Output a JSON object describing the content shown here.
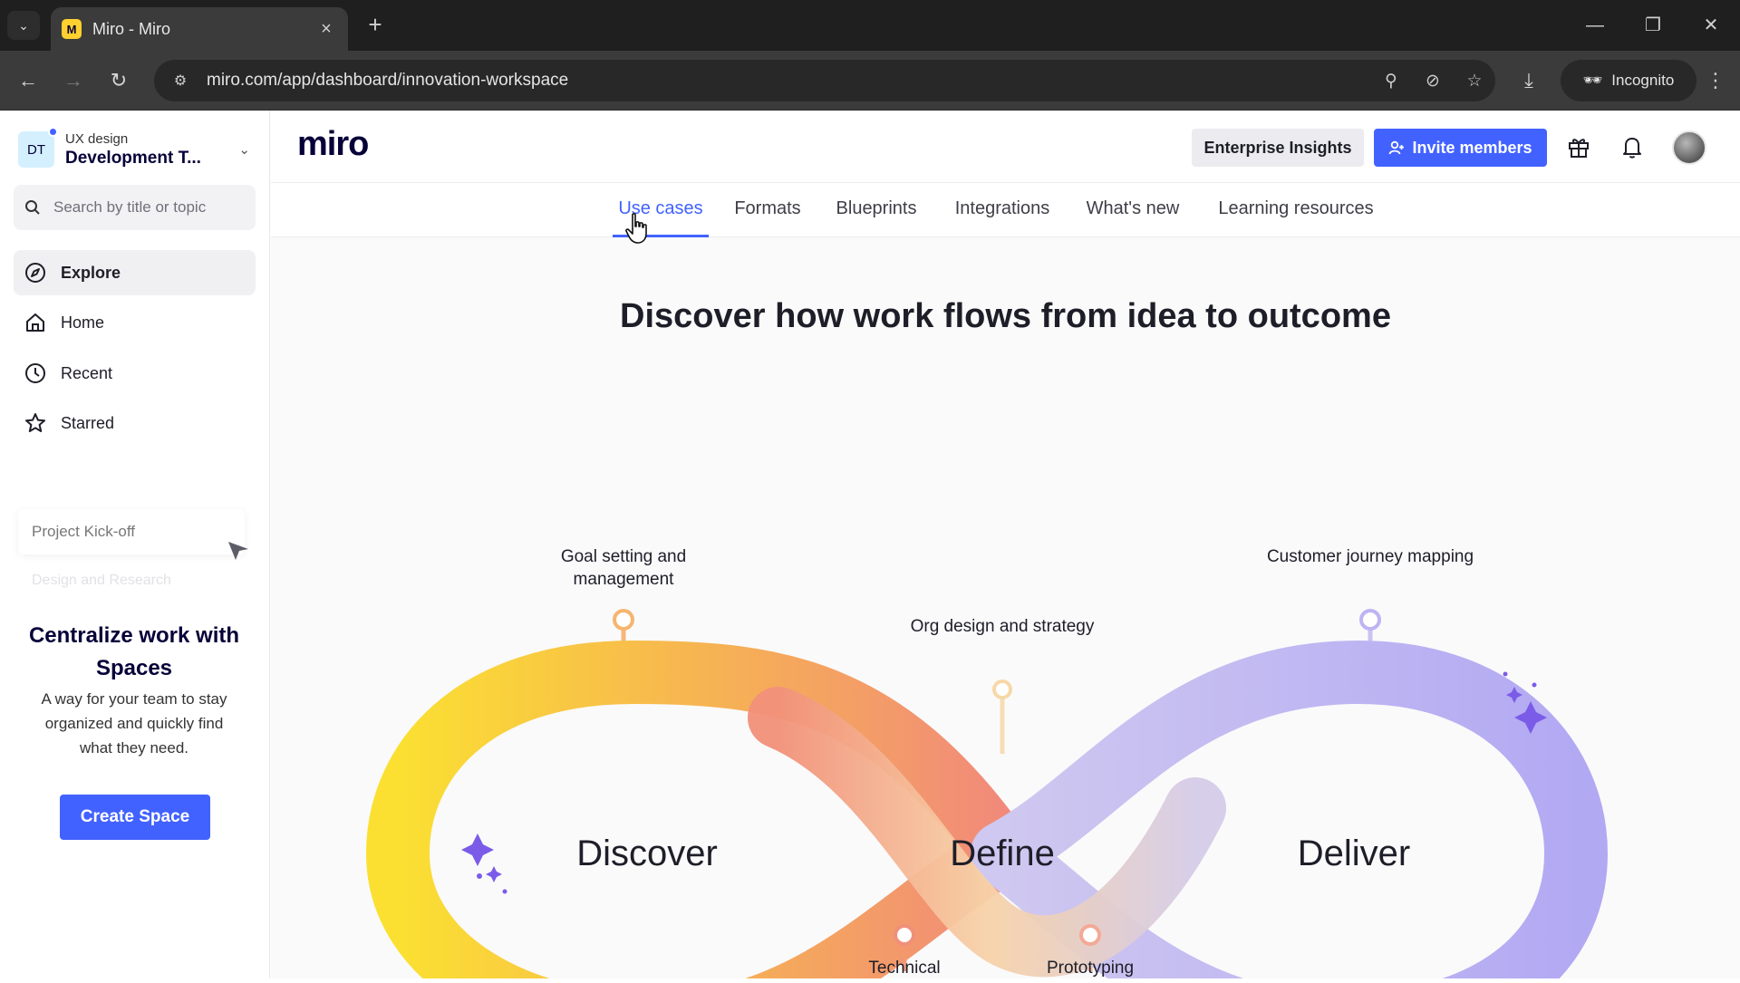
{
  "browser": {
    "tab_title": "Miro - Miro",
    "url": "miro.com/app/dashboard/innovation-workspace",
    "incognito_label": "Incognito",
    "favicon_letter": "M"
  },
  "sidebar": {
    "workspace": {
      "initials": "DT",
      "org": "UX design",
      "name": "Development T..."
    },
    "search_placeholder": "Search by title or topic",
    "items": [
      {
        "label": "Explore",
        "icon": "compass-icon",
        "active": true
      },
      {
        "label": "Home",
        "icon": "home-icon"
      },
      {
        "label": "Recent",
        "icon": "clock-icon"
      },
      {
        "label": "Starred",
        "icon": "star-icon"
      }
    ],
    "promo": {
      "preview_card_1": "Project Kick-off",
      "preview_card_2": "Design and Research",
      "title": "Centralize work with Spaces",
      "description": "A way for your team to stay organized and quickly find what they need.",
      "cta": "Create Space"
    }
  },
  "header": {
    "logo": "miro",
    "enterprise_button": "Enterprise Insights",
    "invite_button": "Invite members"
  },
  "subnav": {
    "tabs": [
      {
        "label": "Use cases",
        "active": true
      },
      {
        "label": "Formats"
      },
      {
        "label": "Blueprints"
      },
      {
        "label": "Integrations"
      },
      {
        "label": "What's new"
      },
      {
        "label": "Learning resources"
      }
    ]
  },
  "content": {
    "headline": "Discover how work flows from idea to outcome",
    "stages": [
      "Discover",
      "Define",
      "Deliver"
    ],
    "use_cases": {
      "goal": "Goal setting and management",
      "org": "Org design and strategy",
      "journey": "Customer journey mapping",
      "technical": "Technical",
      "prototyping": "Prototyping"
    },
    "colors": {
      "accent": "#4262ff",
      "yellow": "#fbe031",
      "coral": "#f29179",
      "lavender": "#b7aff5"
    }
  }
}
